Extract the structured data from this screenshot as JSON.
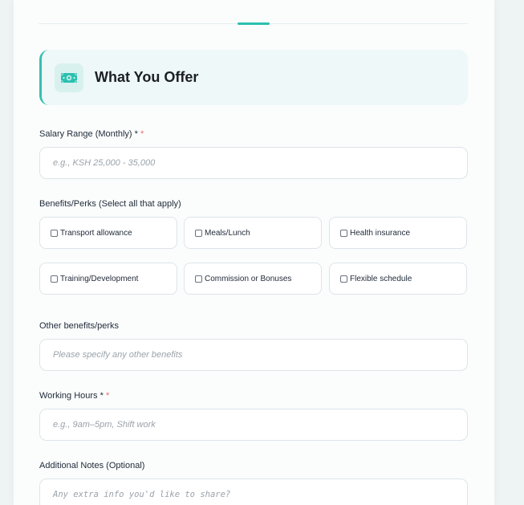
{
  "section": {
    "title": "What You Offer",
    "icon": "money-icon",
    "accent": "#2bc0b0"
  },
  "salary": {
    "label": "Salary Range (Monthly) *",
    "placeholder": "e.g., KSH 25,000 - 35,000"
  },
  "benefits": {
    "label": "Benefits/Perks (Select all that apply)",
    "options": [
      "Transport allowance",
      "Meals/Lunch",
      "Health insurance",
      "Training/Development",
      "Commission or Bonuses",
      "Flexible schedule"
    ]
  },
  "other_benefits": {
    "label": "Other benefits/perks",
    "placeholder": "Please specify any other benefits"
  },
  "working_hours": {
    "label": "Working Hours *",
    "placeholder": "e.g., 9am–5pm, Shift work"
  },
  "notes": {
    "label": "Additional Notes (Optional)",
    "placeholder": "Any extra info you'd like to share?"
  }
}
